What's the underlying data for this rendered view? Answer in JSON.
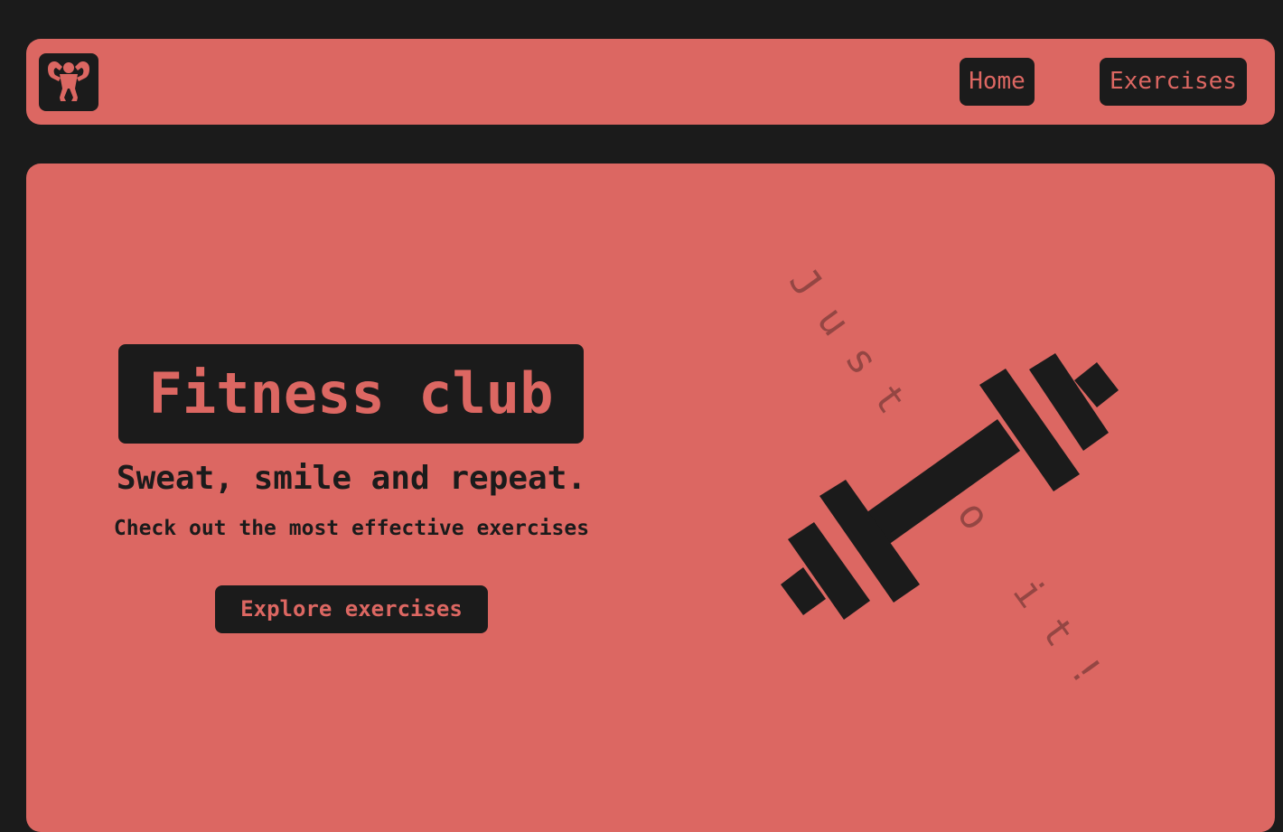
{
  "navbar": {
    "logo_icon": "bodybuilder-icon",
    "home_label": "Home",
    "exercises_label": "Exercises"
  },
  "hero": {
    "title": "Fitness club",
    "subtitle": "Sweat, smile and repeat.",
    "tagline": "Check out the most effective exercises",
    "cta_label": "Explore exercises",
    "illustration_icon": "barbell-icon",
    "slogan": "Just do it!"
  },
  "colors": {
    "background": "#1b1b1b",
    "accent": "#dc6762",
    "dark": "#1b1b1b"
  }
}
